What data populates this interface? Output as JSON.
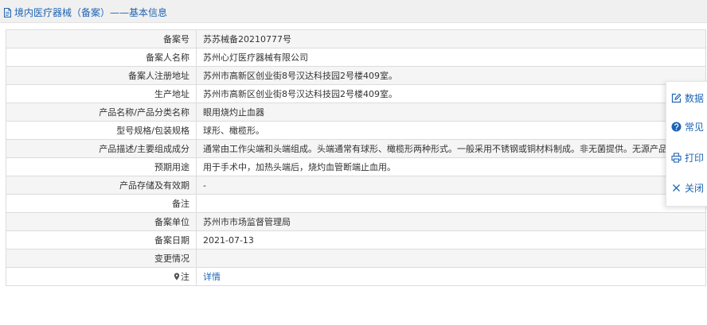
{
  "header": {
    "title": "境内医疗器械（备案）——基本信息"
  },
  "rows": [
    {
      "label": "备案号",
      "value": "苏苏械备20210777号"
    },
    {
      "label": "备案人名称",
      "value": "苏州心灯医疗器械有限公司"
    },
    {
      "label": "备案人注册地址",
      "value": "苏州市高新区创业街8号汉达科技园2号楼409室。"
    },
    {
      "label": "生产地址",
      "value": "苏州市高新区创业街8号汉达科技园2号楼409室。"
    },
    {
      "label": "产品名称/产品分类名称",
      "value": "眼用烧灼止血器"
    },
    {
      "label": "型号规格/包装规格",
      "value": "球形、橄榄形。"
    },
    {
      "label": "产品描述/主要组成成分",
      "value": "通常由工作尖端和头端组成。头端通常有球形、橄榄形两种形式。一般采用不锈钢或铜材料制成。非无菌提供。无源产品。"
    },
    {
      "label": "预期用途",
      "value": "用于手术中，加热头端后，烧灼血管断端止血用。"
    },
    {
      "label": "产品存储及有效期",
      "value": "-"
    },
    {
      "label": "备注",
      "value": ""
    },
    {
      "label": "备案单位",
      "value": "苏州市市场监督管理局"
    },
    {
      "label": "备案日期",
      "value": "2021-07-13"
    },
    {
      "label": "变更情况",
      "value": ""
    }
  ],
  "note_row": {
    "label": "注",
    "link": "详情"
  },
  "floatbar": {
    "items": [
      {
        "label": "数据",
        "icon": "edit-icon"
      },
      {
        "label": "常见",
        "icon": "help-icon"
      },
      {
        "label": "打印",
        "icon": "print-icon"
      },
      {
        "label": "关闭",
        "icon": "close-icon"
      }
    ]
  },
  "colors": {
    "accent": "#1e64b4",
    "row_alt": "#f5f5f5",
    "border": "#dcdcdc"
  }
}
